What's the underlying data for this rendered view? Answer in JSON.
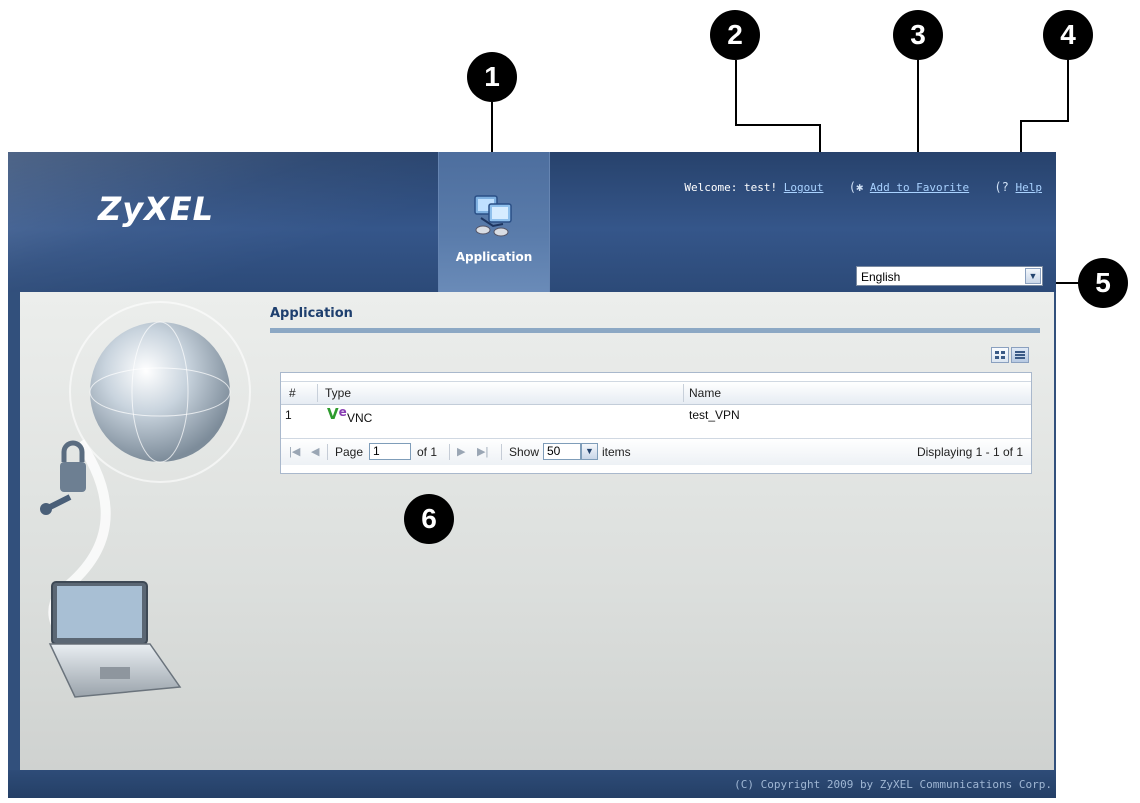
{
  "callouts": [
    "1",
    "2",
    "3",
    "4",
    "5",
    "6"
  ],
  "header": {
    "logo": "ZyXEL",
    "app_button_label": "Application",
    "welcome": "Welcome: test!",
    "logout": "Logout",
    "favorite_glyph": "(✱",
    "add_favorite": "Add to Favorite",
    "help_glyph": "(?",
    "help": "Help",
    "language": "English"
  },
  "page": {
    "title": "Application",
    "columns": [
      "#",
      "Type",
      "Name"
    ],
    "rows": [
      {
        "num": "1",
        "type_icon": "V",
        "type_icon_e": "e",
        "type": "VNC",
        "name": "test_VPN"
      }
    ],
    "pager": {
      "page_label": "Page",
      "page_value": "1",
      "of_label": "of 1",
      "show_label": "Show",
      "show_value": "50",
      "items_label": "items",
      "displaying": "Displaying 1 - 1 of 1"
    }
  },
  "footer": {
    "copyright": "(C) Copyright 2009 by ZyXEL Communications Corp."
  },
  "icons": [
    "application-icon",
    "first-page-icon",
    "prev-page-icon",
    "next-page-icon",
    "last-page-icon",
    "grid-view-icon",
    "list-view-icon",
    "vnc-icon",
    "favorite-icon",
    "help-icon"
  ],
  "colors": {
    "header": "#32507c",
    "link": "#a9d2ff",
    "title": "#1e3f6e",
    "vnc_green": "#2e9b2e",
    "vnc_purple": "#8a3fb4"
  }
}
